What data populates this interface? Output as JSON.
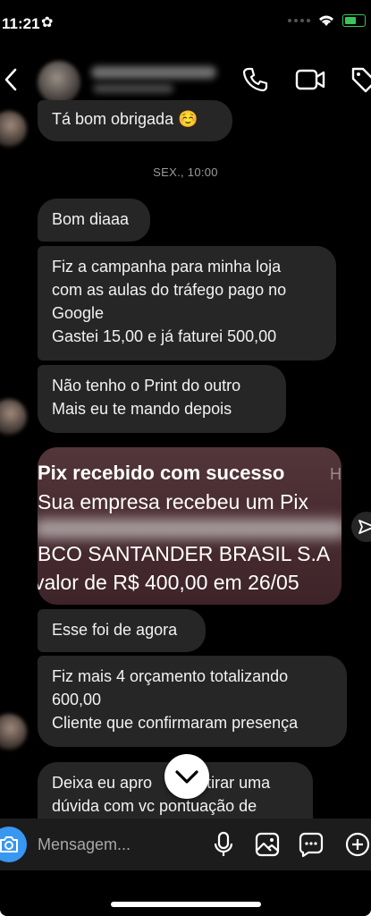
{
  "status_bar": {
    "time": "11:21"
  },
  "header": {
    "contact_name": ""
  },
  "messages": [
    {
      "text": "Tá bom obrigada ☺️"
    },
    {
      "text": "Bom diaaa"
    },
    {
      "line1": "Fiz a campanha para minha loja",
      "line2": "com as aulas do tráfego pago no",
      "line3": "Google",
      "line4": "Gastei 15,00 e já faturei 500,00"
    },
    {
      "line1": "Não tenho o Print do outro",
      "line2": "Mais eu te mando depois"
    },
    {
      "text": "Esse foi de agora"
    },
    {
      "line1": "Fiz mais 4 orçamento totalizando",
      "line2": "600,00",
      "line3": "Cliente que confirmaram presença"
    },
    {
      "line1": "Deixa eu apro",
      "line1b": "e tirar uma",
      "line2": "dúvida com vc pontuação de"
    }
  ],
  "timestamp": "SEX., 10:00",
  "pix_image": {
    "line1": "Pix recebido com sucesso",
    "line2": "Sua empresa recebeu um Pix",
    "line3": "BCO SANTANDER BRASIL S.A",
    "line4": "valor de R$ 400,00 em 26/05",
    "edge_char": "H"
  },
  "composer": {
    "placeholder": "Mensagem..."
  }
}
